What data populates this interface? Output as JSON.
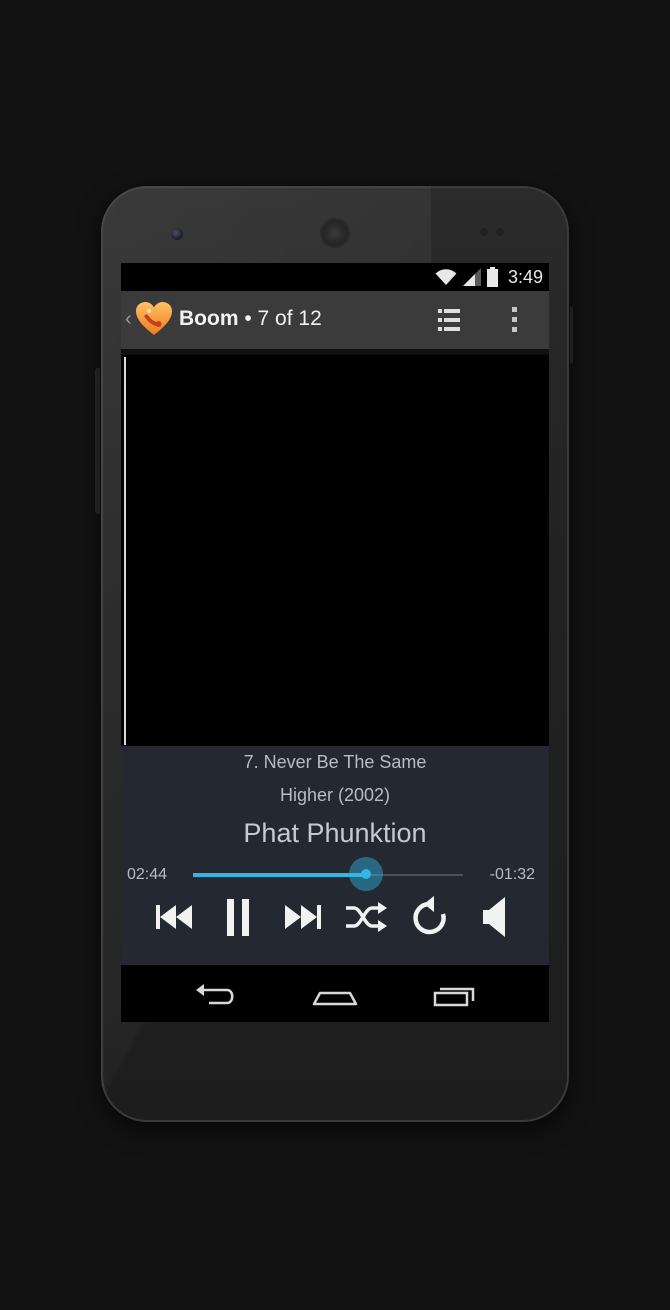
{
  "status_bar": {
    "time": "3:49"
  },
  "action_bar": {
    "up_caret": "‹",
    "app_name": "Boom",
    "separator": " • ",
    "position": "7 of 12",
    "icons": {
      "app": "boom-heart-logo-icon",
      "list": "queue-list-icon",
      "overflow": "overflow-menu-icon"
    }
  },
  "now_playing": {
    "track": "7. Never Be The Same",
    "album": "Higher (2002)",
    "artist": "Phat Phunktion",
    "elapsed": "02:44",
    "remaining": "-01:32",
    "progress": 0.64
  },
  "controls": {
    "icons": [
      "previous-icon",
      "pause-icon",
      "next-icon",
      "shuffle-icon",
      "repeat-icon",
      "volume-icon"
    ]
  },
  "nav_bar": {
    "icons": [
      "back-icon",
      "home-icon",
      "recent-apps-icon"
    ]
  },
  "colors": {
    "accent": "#33b5e5",
    "action_bar": "#3b3b3b",
    "info_panel": "#242830"
  }
}
